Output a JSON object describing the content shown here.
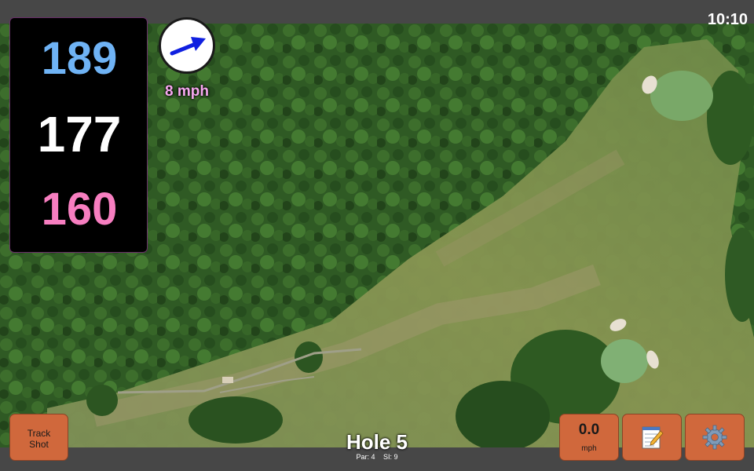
{
  "status": {
    "time": "10:10"
  },
  "yardages": {
    "back": "189",
    "middle": "177",
    "front": "160"
  },
  "wind": {
    "speed": "8 mph",
    "direction_icon": "wind-arrow-icon",
    "arrow_color": "#1020e0"
  },
  "hole": {
    "title": "Hole 5",
    "par": "Par: 4",
    "stroke_index": "SI: 9"
  },
  "buttons": {
    "track_shot": {
      "line1": "Track",
      "line2": "Shot"
    },
    "speed": {
      "value": "0.0",
      "unit": "mph"
    },
    "notes_icon": "notepad-icon",
    "settings_icon": "gear-icon"
  },
  "colors": {
    "button_bg": "#d0683c",
    "back_yardage": "#6fb3f5",
    "middle_yardage": "#ffffff",
    "front_yardage": "#f77ec0",
    "wind_text": "#f7a8f0",
    "bar": "#474747"
  }
}
